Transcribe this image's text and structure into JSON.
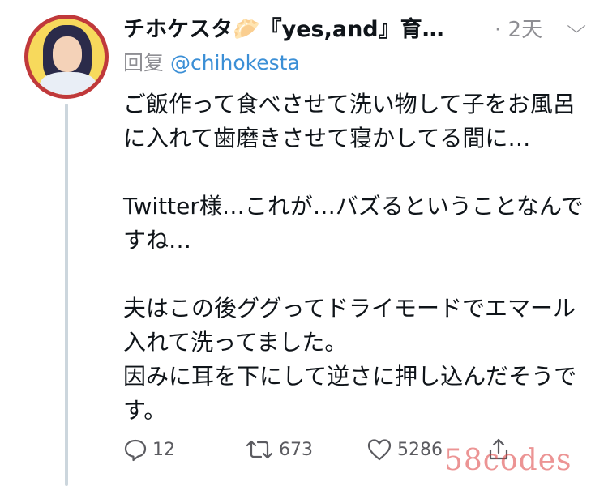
{
  "tweet": {
    "display_name": "チホケスタ",
    "display_name_suffix": "『yes,and』育…",
    "time": "· 2天",
    "reply_label": "回复",
    "reply_handle": "@chihokesta",
    "paragraphs": [
      "ご飯作って食べさせて洗い物して子をお風呂に入れて歯磨きさせて寝かしてる間に…",
      "Twitter様…これが…バズるということなんですね…",
      "夫はこの後ググってドライモードでエマール入れて洗ってました。\n因みに耳を下にして逆さに押し込んだそうです。"
    ]
  },
  "actions": {
    "reply_count": "12",
    "retweet_count": "673",
    "like_count": "5286"
  },
  "icons": [
    "reply-icon",
    "retweet-icon",
    "like-icon",
    "share-icon",
    "chevron-down-icon",
    "gyoza-emoji-icon"
  ],
  "watermark": "58codes",
  "colors": {
    "handle": "#3b8fd6",
    "muted": "#8e8e93",
    "avatar_ring": "#c0393b",
    "avatar_bg": "#f7d95c"
  }
}
